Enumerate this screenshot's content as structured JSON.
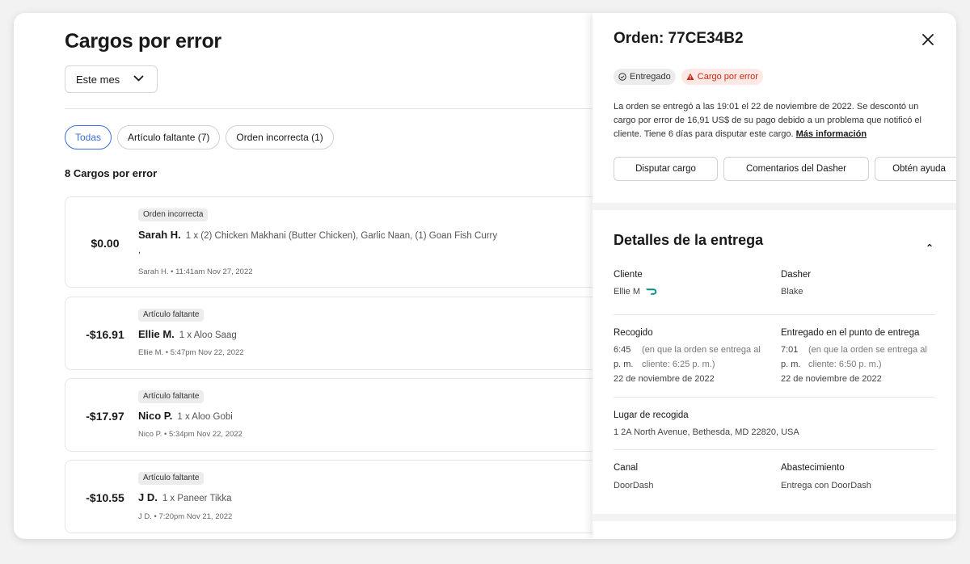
{
  "main": {
    "title": "Cargos por error",
    "month_select": "Este mes",
    "filters": [
      {
        "label": "Todas"
      },
      {
        "label": "Artículo faltante (7)"
      },
      {
        "label": "Orden incorrecta (1)"
      }
    ],
    "count_label": "8 Cargos por error",
    "charges": [
      {
        "amount": "$0.00",
        "tag": "Orden incorrecta",
        "name": "Sarah H.",
        "items": "1 x (2) Chicken Makhani (Butter Chicken), Garlic Naan, (1) Goan Fish Curry",
        "extra": ",",
        "meta": "Sarah H. • 11:41am Nov 27, 2022"
      },
      {
        "amount": "-$16.91",
        "tag": "Artículo faltante",
        "name": "Ellie M.",
        "items": "1 x Aloo Saag",
        "meta": "Ellie M. • 5:47pm Nov 22, 2022"
      },
      {
        "amount": "-$17.97",
        "tag": "Artículo faltante",
        "name": "Nico P.",
        "items": "1 x Aloo Gobi",
        "meta": "Nico P. • 5:34pm Nov 22, 2022"
      },
      {
        "amount": "-$10.55",
        "tag": "Artículo faltante",
        "name": "J D.",
        "items": "1 x Paneer Tikka",
        "meta": "J D. • 7:20pm Nov 21, 2022"
      }
    ]
  },
  "panel": {
    "order_title": "Orden: 77CE34B2",
    "badge_delivered": "Entregado",
    "badge_error": "Cargo por error",
    "description": "La orden se entregó a las 19:01 el 22 de noviembre de 2022. Se descontó un cargo por error de 16,91 US$ de su pago debido a un problema que notificó el cliente. Tiene 6 días para disputar este cargo.",
    "more_info": "Más información",
    "actions": [
      "Disputar cargo",
      "Comentarios del Dasher",
      "Obtén ayuda"
    ],
    "section_title": "Detalles de la entrega",
    "customer_label": "Cliente",
    "customer_value": "Ellie M",
    "dasher_label": "Dasher",
    "dasher_value": "Blake",
    "pickup_label": "Recogido",
    "pickup_time_a": "6:45",
    "pickup_time_b": "p. m.",
    "pickup_note_a": "(en que la orden se entrega al",
    "pickup_note_b": "cliente: 6:25 p. m.)",
    "pickup_date": "22 de noviembre de 2022",
    "dropoff_label": "Entregado en el punto de entrega",
    "dropoff_time_a": "7:01",
    "dropoff_time_b": "p. m.",
    "dropoff_note_a": "(en que la orden se entrega al",
    "dropoff_note_b": "cliente: 6:50 p. m.)",
    "dropoff_date": "22 de noviembre de 2022",
    "pickup_place_label": "Lugar de recogida",
    "pickup_place_value": "1 2A North Avenue, Bethesda, MD 22820, USA",
    "channel_label": "Canal",
    "channel_value": "DoorDash",
    "fulfillment_label": "Abastecimiento",
    "fulfillment_value": "Entrega con DoorDash"
  },
  "colors": {
    "accent": "#3b6fd8",
    "error": "#c42a12",
    "dasher_teal": "#0b8a8a"
  }
}
